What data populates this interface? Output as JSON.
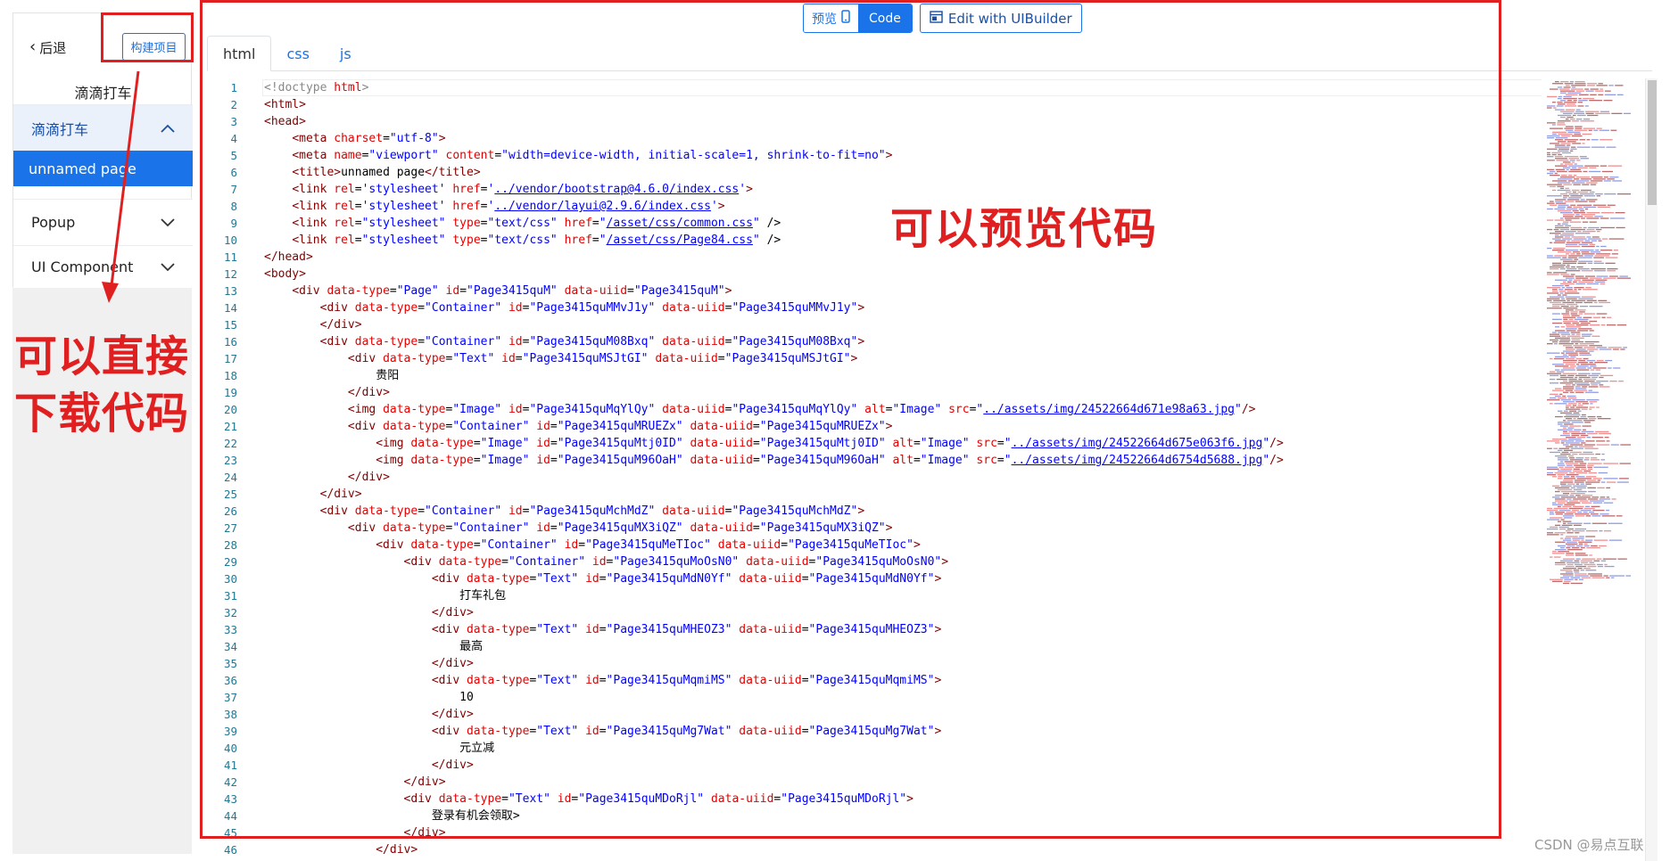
{
  "sidebar": {
    "back_label": "后退",
    "build_label": "构建项目",
    "project_name": "滴滴打车",
    "groups": [
      {
        "label": "滴滴打车",
        "expanded": true
      },
      {
        "label": "Popup",
        "expanded": false
      },
      {
        "label": "UI Component",
        "expanded": false
      }
    ],
    "active_page": "unnamed page"
  },
  "annotations": {
    "left_line1": "可以直接",
    "left_line2": "下载代码",
    "preview": "可以预览代码"
  },
  "toolbar": {
    "preview_label": "预览",
    "code_label": "Code",
    "uibuilder_label": "Edit with UIBuilder"
  },
  "tabs": [
    "html",
    "css",
    "js"
  ],
  "watermark": "CSDN @易点互联",
  "colors": {
    "accent": "#1a73e8",
    "annotation": "#e02020"
  },
  "code_lines": [
    "<!doctype html>",
    "<html>",
    "<head>",
    "    <meta charset=\"utf-8\">",
    "    <meta name=\"viewport\" content=\"width=device-width, initial-scale=1, shrink-to-fit=no\">",
    "    <title>unnamed page</title>",
    "    <link rel='stylesheet' href='../vendor/bootstrap@4.6.0/index.css'>",
    "    <link rel='stylesheet' href='../vendor/layui@2.9.6/index.css'>",
    "    <link rel=\"stylesheet\" type=\"text/css\" href=\"/asset/css/common.css\" />",
    "    <link rel=\"stylesheet\" type=\"text/css\" href=\"/asset/css/Page84.css\" />",
    "</head>",
    "<body>",
    "    <div data-type=\"Page\" id=\"Page3415quM\" data-uiid=\"Page3415quM\">",
    "        <div data-type=\"Container\" id=\"Page3415quMMvJ1y\" data-uiid=\"Page3415quMMvJ1y\">",
    "        </div>",
    "        <div data-type=\"Container\" id=\"Page3415quM08Bxq\" data-uiid=\"Page3415quM08Bxq\">",
    "            <div data-type=\"Text\" id=\"Page3415quMSJtGI\" data-uiid=\"Page3415quMSJtGI\">",
    "                贵阳",
    "            </div>",
    "            <img data-type=\"Image\" id=\"Page3415quMqYlQy\" data-uiid=\"Page3415quMqYlQy\" alt=\"Image\" src=\"../assets/img/24522664d671e98a63.jpg\"/>",
    "            <div data-type=\"Container\" id=\"Page3415quMRUEZx\" data-uiid=\"Page3415quMRUEZx\">",
    "                <img data-type=\"Image\" id=\"Page3415quMtj0ID\" data-uiid=\"Page3415quMtj0ID\" alt=\"Image\" src=\"../assets/img/24522664d675e063f6.jpg\"/>",
    "                <img data-type=\"Image\" id=\"Page3415quM96OaH\" data-uiid=\"Page3415quM96OaH\" alt=\"Image\" src=\"../assets/img/24522664d6754d5688.jpg\"/>",
    "            </div>",
    "        </div>",
    "        <div data-type=\"Container\" id=\"Page3415quMchMdZ\" data-uiid=\"Page3415quMchMdZ\">",
    "            <div data-type=\"Container\" id=\"Page3415quMX3iQZ\" data-uiid=\"Page3415quMX3iQZ\">",
    "                <div data-type=\"Container\" id=\"Page3415quMeTIoc\" data-uiid=\"Page3415quMeTIoc\">",
    "                    <div data-type=\"Container\" id=\"Page3415quMoOsN0\" data-uiid=\"Page3415quMoOsN0\">",
    "                        <div data-type=\"Text\" id=\"Page3415quMdN0Yf\" data-uiid=\"Page3415quMdN0Yf\">",
    "                            打车礼包",
    "                        </div>",
    "                        <div data-type=\"Text\" id=\"Page3415quMHEOZ3\" data-uiid=\"Page3415quMHEOZ3\">",
    "                            最高",
    "                        </div>",
    "                        <div data-type=\"Text\" id=\"Page3415quMqmiMS\" data-uiid=\"Page3415quMqmiMS\">",
    "                            10",
    "                        </div>",
    "                        <div data-type=\"Text\" id=\"Page3415quMg7Wat\" data-uiid=\"Page3415quMg7Wat\">",
    "                            元立减",
    "                        </div>",
    "                    </div>",
    "                    <div data-type=\"Text\" id=\"Page3415quMDoRjl\" data-uiid=\"Page3415quMDoRjl\">",
    "                        登录有机会领取>",
    "                    </div>",
    "                </div>"
  ]
}
